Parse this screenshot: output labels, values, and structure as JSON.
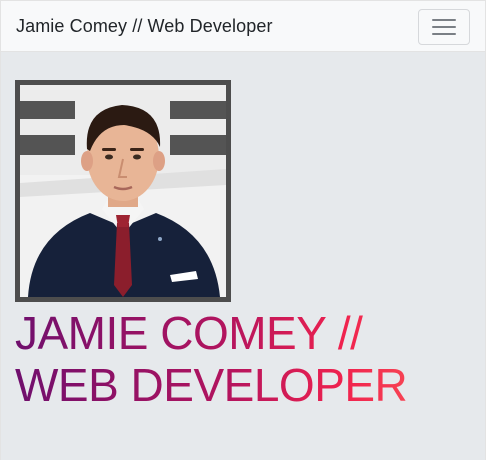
{
  "navbar": {
    "brand": "Jamie Comey // Web Developer",
    "toggle_icon": "hamburger-menu-icon"
  },
  "hero": {
    "photo_alt": "Jamie Comey",
    "title_line1": "JAMIE COMEY //",
    "title_line2": "WEB DEVELOPER"
  },
  "colors": {
    "navbar_bg": "#f8f9fa",
    "page_bg": "#e6e9ec",
    "gradient_start": "#6f0f6d",
    "gradient_end": "#ff6b5a",
    "frame": "#4d4d4d"
  }
}
